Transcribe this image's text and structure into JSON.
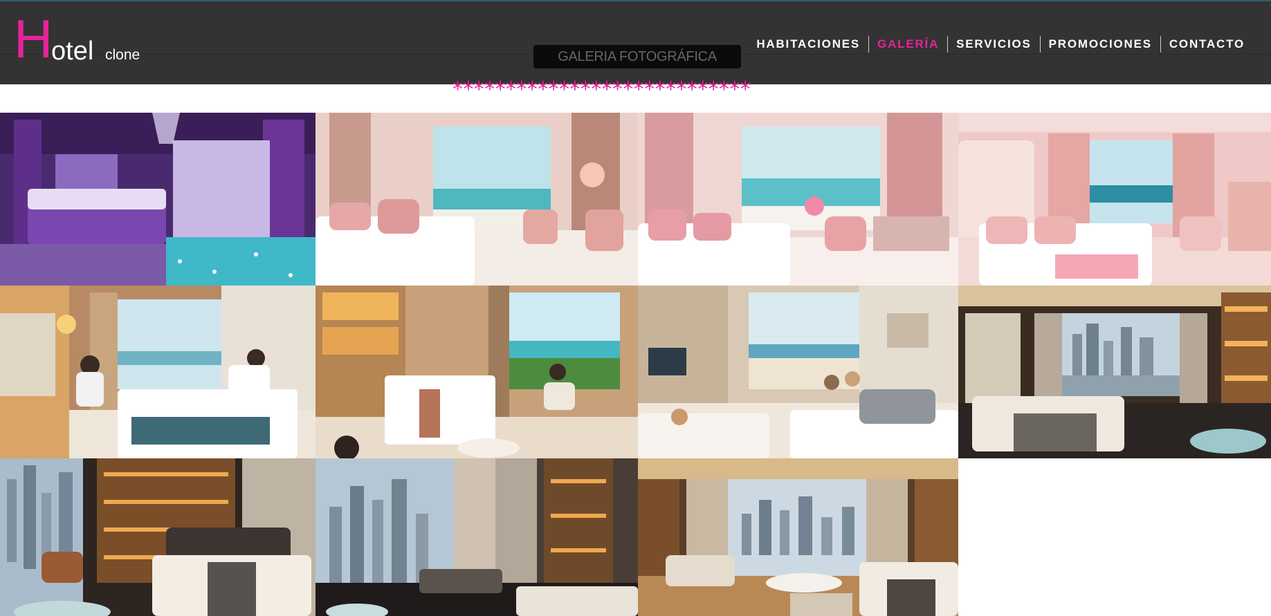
{
  "logo": {
    "initial": "H",
    "rest": "otel",
    "suffix": "clone"
  },
  "gallery_title": "GALERIA FOTOGRÁFICA",
  "divider": "****************************",
  "nav": {
    "items": [
      {
        "label": "HABITACIONES",
        "active": false
      },
      {
        "label": "GALERÍA",
        "active": true
      },
      {
        "label": "SERVICIOS",
        "active": false
      },
      {
        "label": "PROMOCIONES",
        "active": false
      },
      {
        "label": "CONTACTO",
        "active": false
      }
    ]
  },
  "colors": {
    "accent": "#e6239a",
    "header_bg": "#333333"
  },
  "photos": [
    {
      "theme": "purple"
    },
    {
      "theme": "pink"
    },
    {
      "theme": "pink"
    },
    {
      "theme": "pink"
    },
    {
      "theme": "warm"
    },
    {
      "theme": "warm"
    },
    {
      "theme": "beach"
    },
    {
      "theme": "city"
    },
    {
      "theme": "city"
    },
    {
      "theme": "city"
    },
    {
      "theme": "city"
    }
  ]
}
